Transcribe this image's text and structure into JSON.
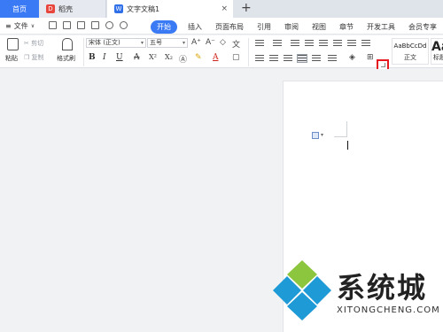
{
  "tabs": {
    "home": "首页",
    "docer": "稻壳",
    "document": "文字文稿1",
    "close": "×",
    "new": "+"
  },
  "menubar": {
    "file": "文件",
    "items": [
      "开始",
      "插入",
      "页面布局",
      "引用",
      "审阅",
      "视图",
      "章节",
      "开发工具",
      "会员专享"
    ]
  },
  "ribbon": {
    "paste": "粘贴",
    "cut": "剪切",
    "copy": "复制",
    "format_painter": "格式刷",
    "font_name": "宋体 (正文)",
    "font_size": "五号",
    "bold": "B",
    "italic": "I",
    "underline": "U",
    "strike": "A",
    "superscript": "X²",
    "subscript": "X₂",
    "grow_font": "A⁺",
    "shrink_font": "A⁻",
    "font_color": "A",
    "styles": [
      {
        "sample": "AaBbCcDd",
        "name": "正文"
      },
      {
        "sample": "Aa",
        "name": "标题"
      }
    ]
  },
  "watermark": {
    "brand": "系统城",
    "url": "XITONGCHENG.COM"
  },
  "colors": {
    "accent": "#3a7af4",
    "highlight_box": "#e5191f"
  }
}
